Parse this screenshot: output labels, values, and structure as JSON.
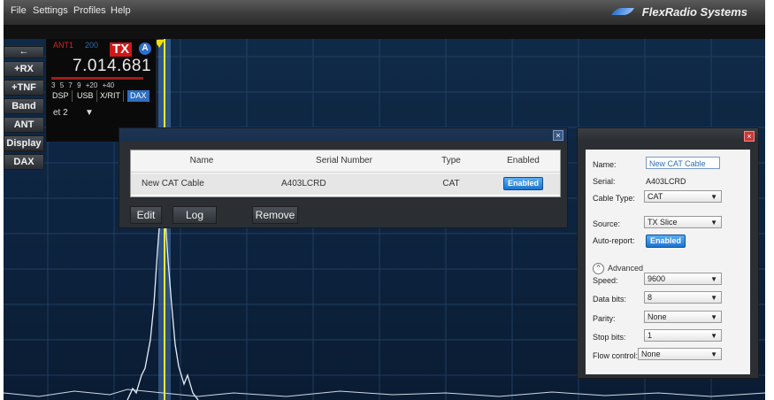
{
  "menubar": {
    "items": [
      "File",
      "Settings",
      "Profiles",
      "Help"
    ],
    "brand": "FlexRadio Systems"
  },
  "side_buttons": [
    "+RX",
    "+TNF",
    "Band",
    "ANT",
    "Display",
    "DAX"
  ],
  "slice_flag": {
    "ant": "ANT1",
    "ant_rx": "200",
    "tx_label": "TX",
    "slice_letter": "A",
    "frequency": "7.014.681",
    "scale": [
      "3",
      "5",
      "7",
      "9",
      "+20",
      "+40"
    ],
    "tabs": [
      "DSP",
      "USB",
      "X/RIT",
      "DAX"
    ],
    "active_tab": "DAX",
    "dax_channel": "et 2"
  },
  "cat_list_dialog": {
    "columns": [
      "Name",
      "Serial Number",
      "Type",
      "Enabled"
    ],
    "rows": [
      {
        "name": "New CAT Cable",
        "serial": "A403LCRD",
        "type": "CAT",
        "enabled": "Enabled"
      }
    ],
    "buttons": {
      "edit": "Edit",
      "log": "Log",
      "remove": "Remove"
    },
    "close": "×"
  },
  "cable_editor": {
    "close": "×",
    "fields": {
      "name_label": "Name:",
      "name_value": "New CAT Cable",
      "serial_label": "Serial:",
      "serial_value": "A403LCRD",
      "cable_type_label": "Cable Type:",
      "cable_type_value": "CAT",
      "source_label": "Source:",
      "source_value": "TX Slice",
      "auto_report_label": "Auto-report:",
      "auto_report_value": "Enabled",
      "advanced_label": "Advanced",
      "speed_label": "Speed:",
      "speed_value": "9600",
      "data_bits_label": "Data bits:",
      "data_bits_value": "8",
      "parity_label": "Parity:",
      "parity_value": "None",
      "stop_bits_label": "Stop bits:",
      "stop_bits_value": "1",
      "flow_control_label": "Flow control:",
      "flow_control_value": "None"
    }
  },
  "colors": {
    "accent": "#2f6fc0",
    "tx_red": "#d01818",
    "panadapter_bg": "#0d2440",
    "enabled_badge": "#1c74d0"
  }
}
